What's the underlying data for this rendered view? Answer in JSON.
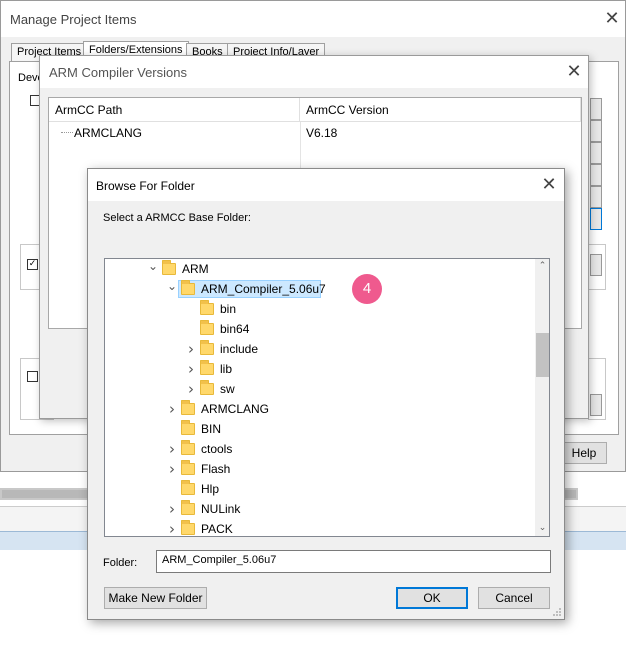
{
  "manage_window": {
    "title": "Manage Project Items",
    "tabs": [
      {
        "label": "Project Items",
        "active": false
      },
      {
        "label": "Folders/Extensions",
        "active": true
      },
      {
        "label": "Books",
        "active": false
      },
      {
        "label": "Project Info/Layer",
        "active": false
      }
    ],
    "partial_label": "Deve",
    "help_label": "Help"
  },
  "armc_window": {
    "title": "ARM Compiler Versions",
    "columns": [
      "ArmCC Path",
      "ArmCC Version"
    ],
    "rows": [
      {
        "path": "ARMCLANG",
        "version": "V6.18"
      }
    ]
  },
  "browse_window": {
    "title": "Browse For Folder",
    "description": "Select a ARMCC Base Folder:",
    "tree": [
      {
        "label": "ARM",
        "level": 0,
        "state": "expanded",
        "selected": false
      },
      {
        "label": "ARM_Compiler_5.06u7",
        "level": 1,
        "state": "expanded",
        "selected": true
      },
      {
        "label": "bin",
        "level": 2,
        "state": "leaf",
        "selected": false
      },
      {
        "label": "bin64",
        "level": 2,
        "state": "leaf",
        "selected": false
      },
      {
        "label": "include",
        "level": 2,
        "state": "collapsed",
        "selected": false
      },
      {
        "label": "lib",
        "level": 2,
        "state": "collapsed",
        "selected": false
      },
      {
        "label": "sw",
        "level": 2,
        "state": "collapsed",
        "selected": false
      },
      {
        "label": "ARMCLANG",
        "level": 1,
        "state": "collapsed",
        "selected": false
      },
      {
        "label": "BIN",
        "level": 1,
        "state": "leaf",
        "selected": false
      },
      {
        "label": "ctools",
        "level": 1,
        "state": "collapsed",
        "selected": false
      },
      {
        "label": "Flash",
        "level": 1,
        "state": "collapsed",
        "selected": false
      },
      {
        "label": "Hlp",
        "level": 1,
        "state": "leaf",
        "selected": false
      },
      {
        "label": "NULink",
        "level": 1,
        "state": "collapsed",
        "selected": false
      },
      {
        "label": "PACK",
        "level": 1,
        "state": "collapsed",
        "selected": false
      }
    ],
    "step_badge": "4",
    "folder_label": "Folder:",
    "folder_value": "ARM_Compiler_5.06u7",
    "buttons": {
      "make_new_folder": "Make New Folder",
      "ok": "OK",
      "cancel": "Cancel"
    }
  },
  "colors": {
    "selection_fill": "#cce8ff",
    "selection_border": "#99d1ff",
    "folder_yellow": "#ffd86b",
    "badge_pink": "#ef5a8e",
    "default_button_border": "#0078d7"
  }
}
